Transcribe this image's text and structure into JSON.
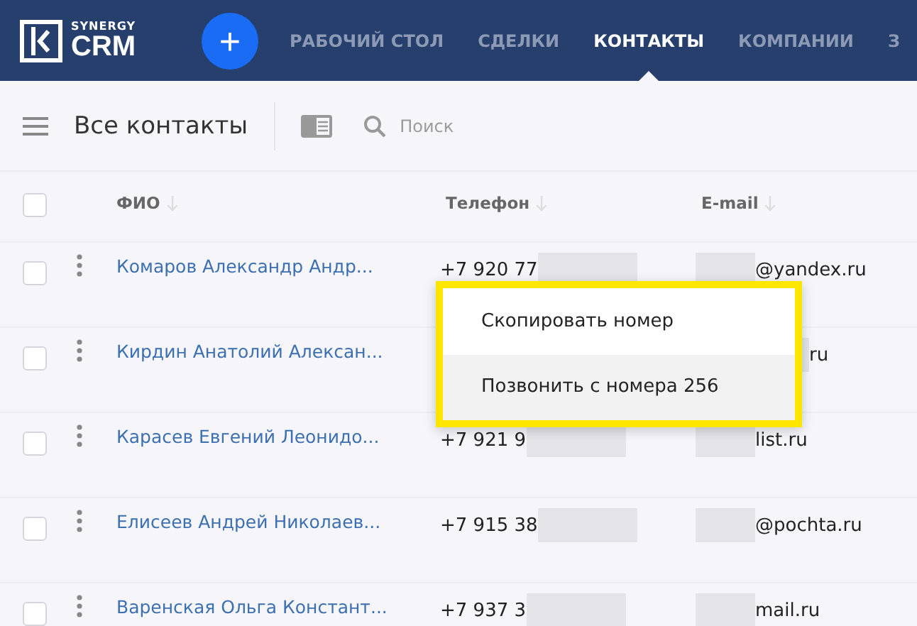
{
  "logo": {
    "small": "SYNERGY",
    "big": "CRM"
  },
  "add_button": {
    "label": "+"
  },
  "nav": [
    {
      "label": "РАБОЧИЙ СТОЛ",
      "selected": false
    },
    {
      "label": "СДЕЛКИ",
      "selected": false
    },
    {
      "label": "КОНТАКТЫ",
      "selected": true
    },
    {
      "label": "КОМПАНИИ",
      "selected": false
    },
    {
      "label": "З",
      "selected": false
    }
  ],
  "toolbar": {
    "title": "Все контакты",
    "search": {
      "placeholder": "Поиск"
    }
  },
  "table": {
    "select_all": {
      "checked": false
    },
    "columns": [
      "ФИО",
      "Телефон",
      "E-mail"
    ],
    "rows": [
      {
        "name": "Комаров Александр Андр...",
        "phone": "+7 920 77",
        "email": "@yandex.ru",
        "checked": false
      },
      {
        "name": "Кирдин Анатолий Алексан...",
        "email": "ru",
        "checked": false
      },
      {
        "name": "Карасев Евгений Леонидо...",
        "phone": "+7 921 9",
        "email": "list.ru",
        "checked": false
      },
      {
        "name": "Елисеев Андрей Николаев...",
        "phone": "+7 915 38",
        "email": "@pochta.ru",
        "checked": false
      },
      {
        "name": "Варенская Ольга Констант...",
        "phone": "+7 937 3",
        "email": "mail.ru",
        "checked": false
      }
    ]
  },
  "context_menu": {
    "items": [
      {
        "label": "Скопировать номер",
        "selected": false
      },
      {
        "label": "Позвонить с номера 256",
        "selected": true
      }
    ]
  }
}
